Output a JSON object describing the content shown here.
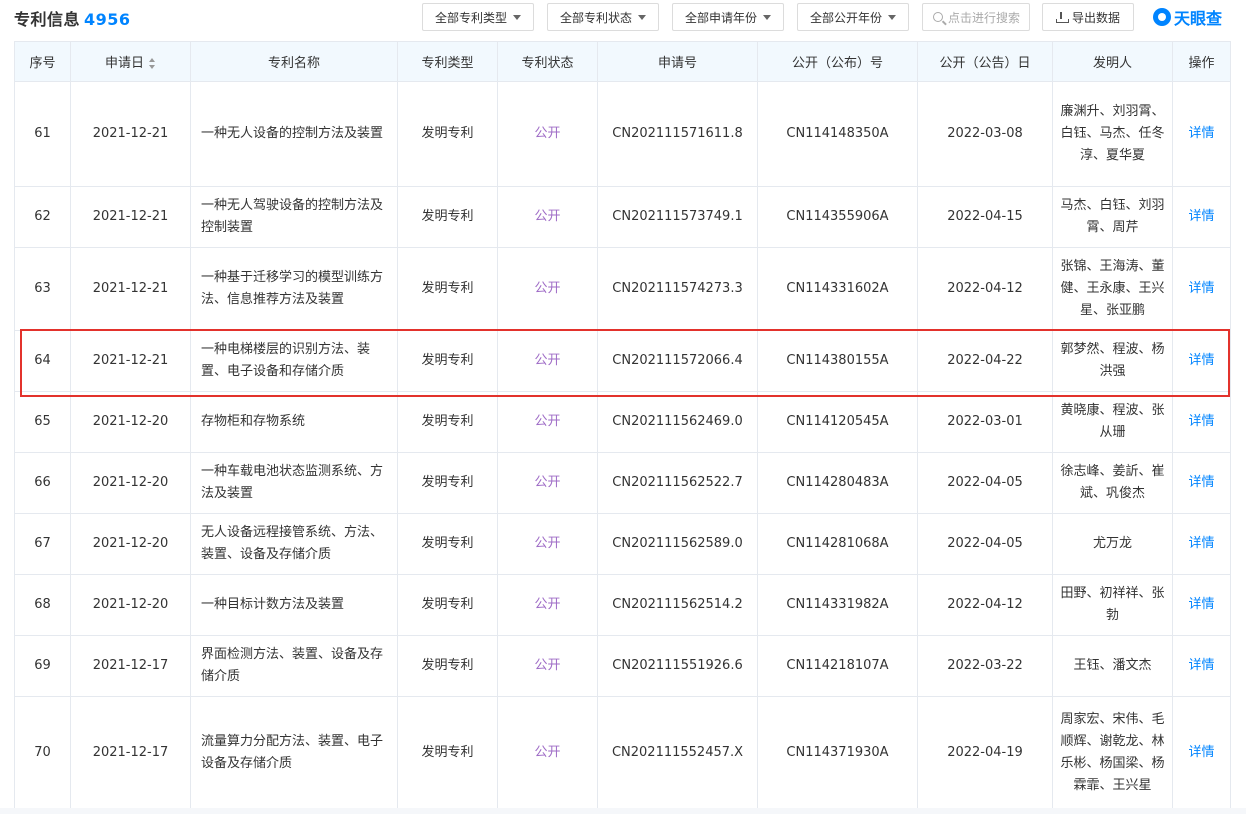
{
  "header": {
    "title": "专利信息",
    "count": "4956",
    "filters": [
      {
        "label": "全部专利类型"
      },
      {
        "label": "全部专利状态"
      },
      {
        "label": "全部申请年份"
      },
      {
        "label": "全部公开年份"
      }
    ],
    "search_placeholder": "点击进行搜索",
    "export_label": "导出数据",
    "logo_text": "天眼查"
  },
  "table": {
    "columns": [
      "序号",
      "申请日",
      "专利名称",
      "专利类型",
      "专利状态",
      "申请号",
      "公开（公布）号",
      "公开（公告）日",
      "发明人",
      "操作"
    ],
    "rows": [
      {
        "no": "61",
        "date": "2021-12-21",
        "name": "一种无人设备的控制方法及装置",
        "type": "发明专利",
        "status": "公开",
        "app_no": "CN202111571611.8",
        "pub_no": "CN114148350A",
        "pub_date": "2022-03-08",
        "inventors": "廉渊升、刘羽霄、白钰、马杰、任冬淳、夏华夏",
        "op": "详情"
      },
      {
        "no": "62",
        "date": "2021-12-21",
        "name": "一种无人驾驶设备的控制方法及控制装置",
        "type": "发明专利",
        "status": "公开",
        "app_no": "CN202111573749.1",
        "pub_no": "CN114355906A",
        "pub_date": "2022-04-15",
        "inventors": "马杰、白钰、刘羽霄、周芹",
        "op": "详情"
      },
      {
        "no": "63",
        "date": "2021-12-21",
        "name": "一种基于迁移学习的模型训练方法、信息推荐方法及装置",
        "type": "发明专利",
        "status": "公开",
        "app_no": "CN202111574273.3",
        "pub_no": "CN114331602A",
        "pub_date": "2022-04-12",
        "inventors": "张锦、王海涛、董健、王永康、王兴星、张亚鹏",
        "op": "详情"
      },
      {
        "no": "64",
        "date": "2021-12-21",
        "name": "一种电梯楼层的识别方法、装置、电子设备和存储介质",
        "type": "发明专利",
        "status": "公开",
        "app_no": "CN202111572066.4",
        "pub_no": "CN114380155A",
        "pub_date": "2022-04-22",
        "inventors": "郭梦然、程波、杨洪强",
        "op": "详情"
      },
      {
        "no": "65",
        "date": "2021-12-20",
        "name": "存物柜和存物系统",
        "type": "发明专利",
        "status": "公开",
        "app_no": "CN202111562469.0",
        "pub_no": "CN114120545A",
        "pub_date": "2022-03-01",
        "inventors": "黄晓康、程波、张从珊",
        "op": "详情"
      },
      {
        "no": "66",
        "date": "2021-12-20",
        "name": "一种车载电池状态监测系统、方法及装置",
        "type": "发明专利",
        "status": "公开",
        "app_no": "CN202111562522.7",
        "pub_no": "CN114280483A",
        "pub_date": "2022-04-05",
        "inventors": "徐志峰、姜訢、崔斌、巩俊杰",
        "op": "详情"
      },
      {
        "no": "67",
        "date": "2021-12-20",
        "name": "无人设备远程接管系统、方法、装置、设备及存储介质",
        "type": "发明专利",
        "status": "公开",
        "app_no": "CN202111562589.0",
        "pub_no": "CN114281068A",
        "pub_date": "2022-04-05",
        "inventors": "尤万龙",
        "op": "详情"
      },
      {
        "no": "68",
        "date": "2021-12-20",
        "name": "一种目标计数方法及装置",
        "type": "发明专利",
        "status": "公开",
        "app_no": "CN202111562514.2",
        "pub_no": "CN114331982A",
        "pub_date": "2022-04-12",
        "inventors": "田野、初祥祥、张勃",
        "op": "详情"
      },
      {
        "no": "69",
        "date": "2021-12-17",
        "name": "界面检测方法、装置、设备及存储介质",
        "type": "发明专利",
        "status": "公开",
        "app_no": "CN202111551926.6",
        "pub_no": "CN114218107A",
        "pub_date": "2022-03-22",
        "inventors": "王钰、潘文杰",
        "op": "详情"
      },
      {
        "no": "70",
        "date": "2021-12-17",
        "name": "流量算力分配方法、装置、电子设备及存储介质",
        "type": "发明专利",
        "status": "公开",
        "app_no": "CN202111552457.X",
        "pub_no": "CN114371930A",
        "pub_date": "2022-04-19",
        "inventors": "周家宏、宋伟、毛顺辉、谢乾龙、林乐彬、杨国梁、杨霖霏、王兴星",
        "op": "详情"
      }
    ]
  }
}
